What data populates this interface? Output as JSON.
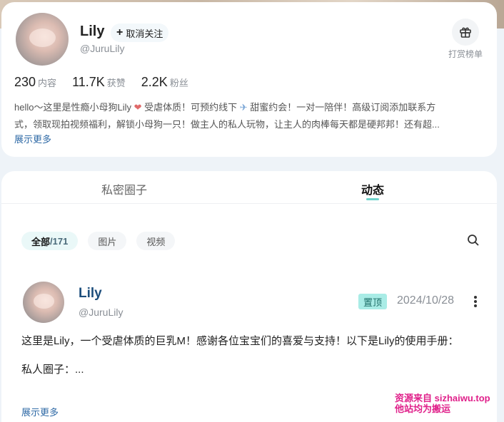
{
  "profile": {
    "name": "Lily",
    "handle": "@JuruLily",
    "follow_label": "取消关注",
    "gift_label": "打赏榜单",
    "stats": [
      {
        "value": "230",
        "label": "内容"
      },
      {
        "value": "11.7K",
        "label": "获赞"
      },
      {
        "value": "2.2K",
        "label": "粉丝"
      }
    ],
    "bio_line1_a": "hello～这里是性瘾小母狗Lily",
    "bio_line1_b": "受虐体质！可预约线下",
    "bio_line1_c": "甜蜜约会！一对一陪伴！高级订阅添加联系方",
    "bio_line2": "式，领取现拍视频福利，解锁小母狗一只！做主人的私人玩物，让主人的肉棒每天都是硬邦邦！还有超...",
    "more_label": "展示更多"
  },
  "tabs": {
    "private": "私密圈子",
    "feed": "动态"
  },
  "filters": {
    "all_label": "全部",
    "all_count": "/171",
    "images": "图片",
    "videos": "视频"
  },
  "post": {
    "name": "Lily",
    "handle": "@JuruLily",
    "pin_label": "置顶",
    "date": "2024/10/28",
    "body_line1": "这里是Lily，一个受虐体质的巨乳M！感谢各位宝宝们的喜爱与支持！以下是Lily的使用手册：",
    "body_line2": "私人圈子：...",
    "more_label": "展示更多"
  },
  "watermark": {
    "line1": "资源来自 sizhaiwu.top",
    "line2": "他站均为搬运"
  },
  "colors": {
    "accent": "#6fd3cc",
    "pin_bg": "#a9ece6",
    "link": "#2f6aa6",
    "watermark": "#e0208a"
  }
}
